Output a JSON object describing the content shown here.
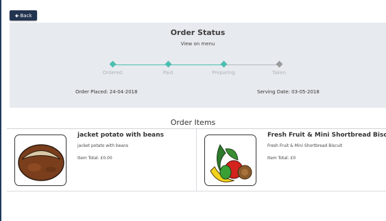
{
  "header": {
    "back_label": "Back",
    "back_icon": "arrow-left-icon"
  },
  "status": {
    "title": "Order Status",
    "link": "View on menu",
    "steps": [
      {
        "label": "Ordered",
        "done": true
      },
      {
        "label": "Paid",
        "done": true
      },
      {
        "label": "Preparing",
        "done": true
      },
      {
        "label": "Taken",
        "done": false
      }
    ],
    "order_placed": "Order Placed: 24-04-2018",
    "serving_date": "Serving Date: 03-05-2018",
    "colors": {
      "done": "#4bbfb0",
      "pending": "#9a9a9a"
    }
  },
  "items_section": {
    "title": "Order Items",
    "items": [
      {
        "name": "jacket potato with beans",
        "description": "jacket potato with beans",
        "total": "Item Total: £0.00",
        "icon": "potato-icon"
      },
      {
        "name": "Fresh Fruit & Mini Shortbread Biscuit",
        "description": "Fresh Fruit & Mini Shortbread Biscuit",
        "total": "Item Total: £0",
        "icon": "fruit-icon"
      }
    ]
  }
}
